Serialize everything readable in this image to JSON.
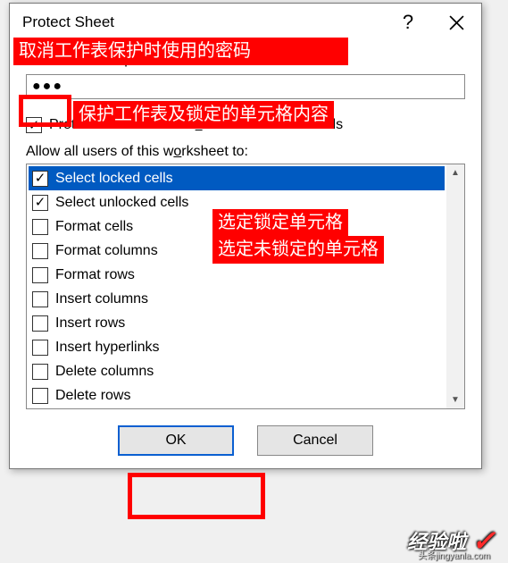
{
  "dialog": {
    "title": "Protect Sheet",
    "help_symbol": "?",
    "password_label_pre": "P",
    "password_label_underline": "a",
    "password_label_post": "ssword to unprotect sheet:",
    "password_value": "●●●",
    "protect_pre": "Protect worksheet and ",
    "protect_underline": "c",
    "protect_post": "ontents of locked cells",
    "allow_pre": "Allow all users of this w",
    "allow_underline": "o",
    "allow_post": "rksheet to:",
    "buttons": {
      "ok": "OK",
      "cancel": "Cancel"
    }
  },
  "list": {
    "items": [
      {
        "label": "Select locked cells",
        "checked": true,
        "selected": true
      },
      {
        "label": "Select unlocked cells",
        "checked": true,
        "selected": false
      },
      {
        "label": "Format cells",
        "checked": false,
        "selected": false
      },
      {
        "label": "Format columns",
        "checked": false,
        "selected": false
      },
      {
        "label": "Format rows",
        "checked": false,
        "selected": false
      },
      {
        "label": "Insert columns",
        "checked": false,
        "selected": false
      },
      {
        "label": "Insert rows",
        "checked": false,
        "selected": false
      },
      {
        "label": "Insert hyperlinks",
        "checked": false,
        "selected": false
      },
      {
        "label": "Delete columns",
        "checked": false,
        "selected": false
      },
      {
        "label": "Delete rows",
        "checked": false,
        "selected": false
      }
    ]
  },
  "annotations": {
    "a1": "取消工作表保护时使用的密码",
    "a2": "保护工作表及锁定的单元格内容",
    "a3": "选定锁定单元格",
    "a4": "选定未锁定的单元格"
  },
  "watermark": {
    "main": "经验啦",
    "sub": "头条jingyanla.com"
  }
}
